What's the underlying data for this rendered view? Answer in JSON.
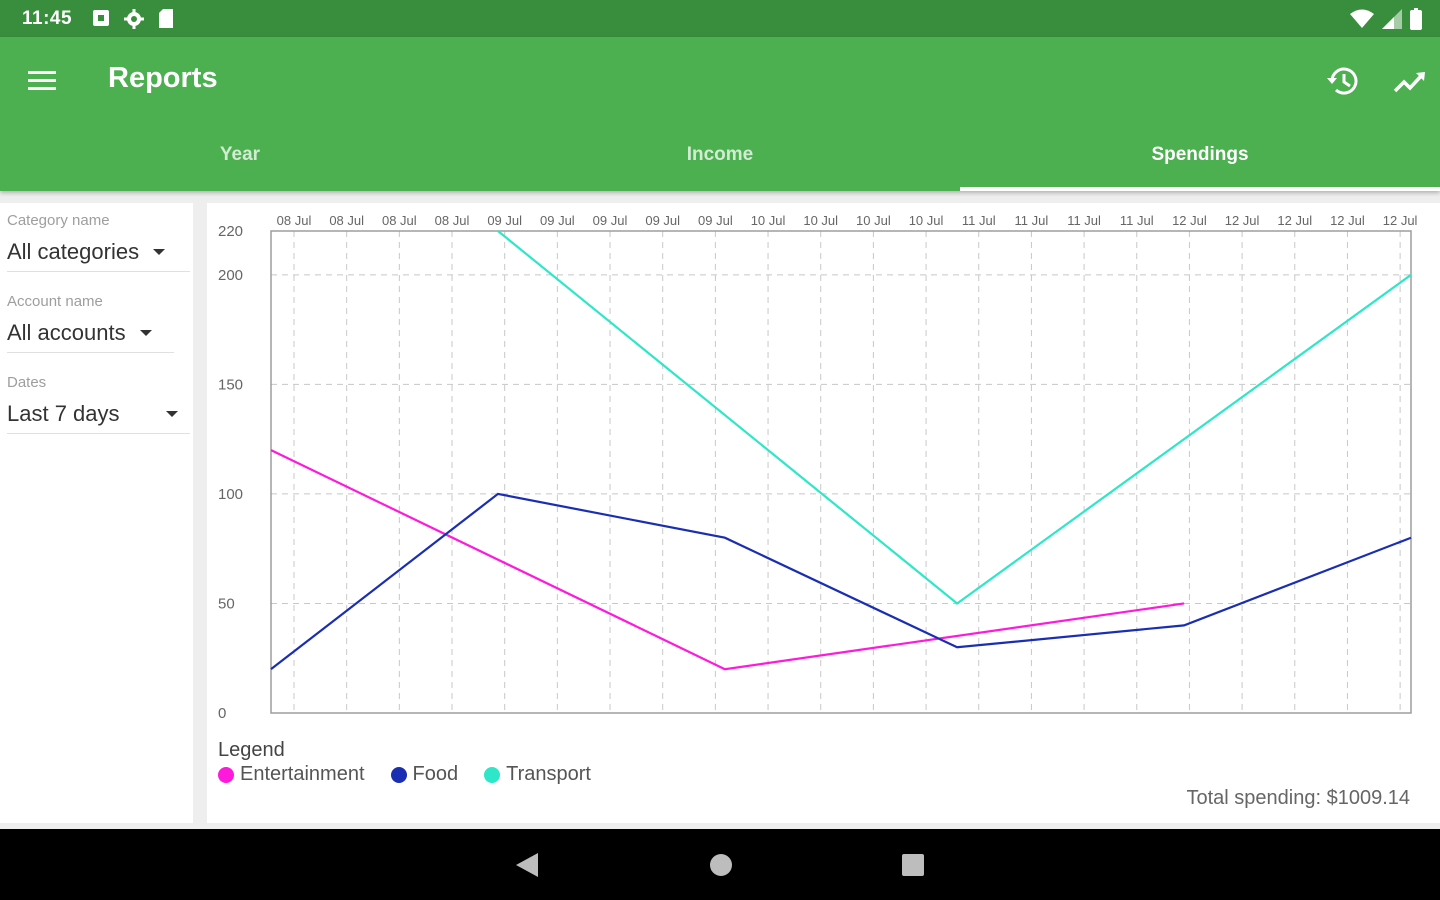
{
  "status": {
    "time": "11:45"
  },
  "appbar": {
    "title": "Reports"
  },
  "tabs": [
    {
      "label": "Year",
      "active": false
    },
    {
      "label": "Income",
      "active": false
    },
    {
      "label": "Spendings",
      "active": true
    }
  ],
  "filters": {
    "category": {
      "label": "Category name",
      "value": "All categories"
    },
    "account": {
      "label": "Account name",
      "value": "All accounts"
    },
    "dates": {
      "label": "Dates",
      "value": "Last 7 days"
    }
  },
  "legend_title": "Legend",
  "total": "Total spending: $1009.14",
  "colors": {
    "primary": "#4caf50",
    "primary_dark": "#388e3c"
  },
  "chart_data": {
    "type": "line",
    "x": [
      "08 Jul",
      "08 Jul",
      "08 Jul",
      "08 Jul",
      "09 Jul",
      "09 Jul",
      "09 Jul",
      "09 Jul",
      "09 Jul",
      "10 Jul",
      "10 Jul",
      "10 Jul",
      "10 Jul",
      "11 Jul",
      "11 Jul",
      "11 Jul",
      "11 Jul",
      "12 Jul",
      "12 Jul",
      "12 Jul",
      "12 Jul",
      "12 Jul"
    ],
    "ylim": [
      0,
      220
    ],
    "yticks": [
      0,
      50,
      100,
      150,
      200,
      220
    ],
    "grid": true,
    "legend_placement": "bottom-left",
    "series": [
      {
        "name": "Entertainment",
        "color": "#ff1adb",
        "points": [
          [
            0,
            120
          ],
          [
            8.6,
            20
          ],
          [
            17.3,
            50
          ]
        ]
      },
      {
        "name": "Food",
        "color": "#1a2eb3",
        "points": [
          [
            0,
            20
          ],
          [
            4.3,
            100
          ],
          [
            8.6,
            80
          ],
          [
            13,
            30
          ],
          [
            17.3,
            40
          ],
          [
            21.6,
            80
          ]
        ]
      },
      {
        "name": "Transport",
        "color": "#2ee6c8",
        "points": [
          [
            4.3,
            220
          ],
          [
            13,
            50
          ],
          [
            21.6,
            200
          ]
        ]
      }
    ]
  }
}
